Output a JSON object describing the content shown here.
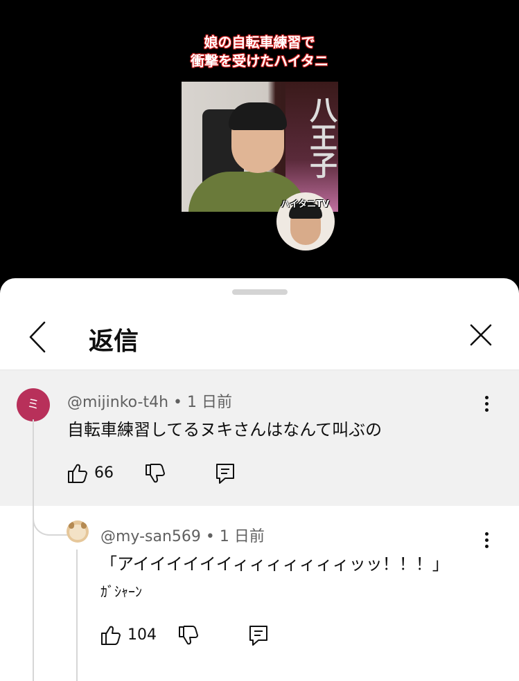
{
  "video": {
    "title_line1": "娘の自転車練習で",
    "title_line2": "衝撃を受けたハイタニ",
    "poster_text": "八王子",
    "channel_label": "ハイタニTV"
  },
  "sheet": {
    "title": "返信",
    "back_icon": "chevron-left-icon",
    "close_icon": "close-icon"
  },
  "comments": [
    {
      "avatar_letter": "ミ",
      "avatar_color": "#b8305a",
      "author": "@mijinko-t4h",
      "time": "• 1 日前",
      "text": "自転車練習してるヌキさんはなんて叫ぶの",
      "likes": "66"
    },
    {
      "avatar_color": "#e6c79a",
      "author": "@my-san569",
      "time": "• 1 日前",
      "text_line1": "「アイイイイイイィィィィィィィッッ！！！」",
      "text_line2": "ｶﾞｼｬｰﾝ",
      "likes": "104"
    }
  ],
  "colors": {
    "background_highlight": "#f1f1f1",
    "text_primary": "#0f0f0f",
    "text_secondary": "#606060"
  }
}
